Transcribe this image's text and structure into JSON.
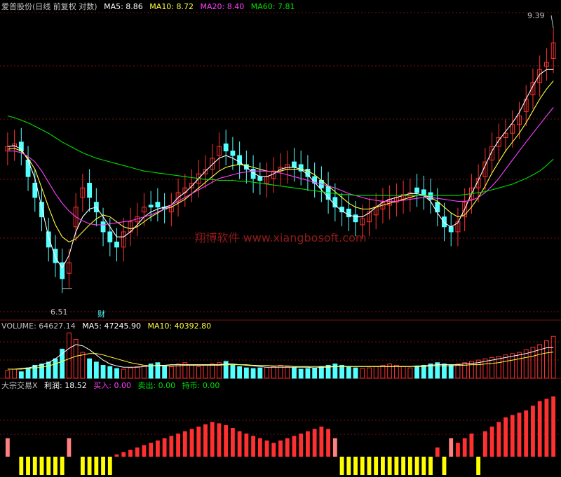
{
  "colors": {
    "background": "#000000",
    "up": "#ff3030",
    "down": "#54ffff",
    "ma5": "#ffffff",
    "ma10": "#ffff40",
    "ma20": "#ff40ff",
    "ma60": "#00e000",
    "grid": "#7a1010",
    "watermark": "#8c1a1a",
    "label": "#c0c0c0",
    "yellow_bar": "#ffff00",
    "pink_bar": "#ff8080",
    "teal_bar": "#33cccc"
  },
  "price_panel": {
    "title": "爱普股份(日线 前复权 对数)",
    "ma5": "MA5: 8.86",
    "ma10": "MA10: 8.72",
    "ma20": "MA20: 8.40",
    "ma60": "MA60: 7.81",
    "high_label": "9.39",
    "low_label": "6.51",
    "caifu_label": "财",
    "watermark": "翔博软件 www.xiangbosoft.com"
  },
  "volume_panel": {
    "title": "VOLUME: 64627.14",
    "ma5": "MA5: 47245.90",
    "ma10": "MA10: 40392.80"
  },
  "indicator_panel": {
    "title": "大宗交易X",
    "profit": "利润: 18.52",
    "buy": "买入: 0.00",
    "sell": "卖出: 0.00",
    "hold": "持币: 0.00"
  },
  "chart_data": {
    "type": "candlestick",
    "price_range": [
      6.3,
      9.6
    ],
    "high": 9.39,
    "low": 6.51,
    "closes": [
      7.95,
      7.98,
      7.9,
      7.62,
      7.4,
      7.2,
      6.9,
      6.75,
      6.6,
      6.75,
      7.3,
      7.5,
      7.4,
      7.25,
      7.05,
      6.95,
      6.9,
      7.05,
      7.15,
      7.2,
      7.3,
      7.3,
      7.3,
      7.28,
      7.3,
      7.45,
      7.5,
      7.55,
      7.65,
      7.7,
      7.82,
      7.95,
      7.9,
      7.85,
      7.75,
      7.7,
      7.6,
      7.58,
      7.62,
      7.68,
      7.72,
      7.75,
      7.72,
      7.68,
      7.62,
      7.55,
      7.5,
      7.38,
      7.3,
      7.25,
      7.2,
      7.15,
      7.18,
      7.25,
      7.3,
      7.35,
      7.38,
      7.4,
      7.43,
      7.45,
      7.45,
      7.42,
      7.38,
      7.25,
      7.1,
      7.05,
      7.15,
      7.35,
      7.5,
      7.6,
      7.78,
      7.95,
      8.05,
      8.1,
      8.2,
      8.3,
      8.5,
      8.7,
      8.86,
      8.95,
      9.2
    ],
    "opens": [
      7.9,
      7.95,
      8.0,
      7.8,
      7.55,
      7.35,
      7.05,
      6.88,
      6.75,
      6.65,
      7.1,
      7.4,
      7.55,
      7.35,
      7.15,
      7.05,
      6.95,
      6.9,
      7.05,
      7.15,
      7.25,
      7.32,
      7.35,
      7.3,
      7.25,
      7.35,
      7.45,
      7.5,
      7.55,
      7.65,
      7.7,
      7.85,
      7.98,
      7.9,
      7.85,
      7.75,
      7.7,
      7.62,
      7.55,
      7.6,
      7.68,
      7.7,
      7.78,
      7.75,
      7.7,
      7.62,
      7.58,
      7.52,
      7.4,
      7.3,
      7.28,
      7.22,
      7.12,
      7.15,
      7.22,
      7.28,
      7.32,
      7.35,
      7.38,
      7.4,
      7.5,
      7.48,
      7.45,
      7.35,
      7.2,
      7.1,
      7.05,
      7.2,
      7.38,
      7.5,
      7.62,
      7.8,
      7.95,
      8.05,
      8.1,
      8.2,
      8.35,
      8.55,
      8.7,
      8.9,
      9.0
    ],
    "ma5": [
      7.95,
      7.96,
      7.92,
      7.8,
      7.6,
      7.3,
      7.0,
      6.8,
      6.7,
      6.82,
      7.05,
      7.2,
      7.28,
      7.3,
      7.2,
      7.1,
      7.0,
      7.0,
      7.05,
      7.12,
      7.2,
      7.25,
      7.28,
      7.3,
      7.32,
      7.4,
      7.45,
      7.52,
      7.6,
      7.68,
      7.75,
      7.82,
      7.85,
      7.82,
      7.78,
      7.72,
      7.66,
      7.62,
      7.62,
      7.65,
      7.7,
      7.72,
      7.72,
      7.7,
      7.64,
      7.56,
      7.48,
      7.4,
      7.32,
      7.26,
      7.22,
      7.2,
      7.2,
      7.24,
      7.3,
      7.35,
      7.38,
      7.4,
      7.42,
      7.44,
      7.44,
      7.42,
      7.36,
      7.24,
      7.14,
      7.1,
      7.14,
      7.28,
      7.44,
      7.58,
      7.74,
      7.9,
      8.02,
      8.12,
      8.22,
      8.34,
      8.5,
      8.66,
      8.8,
      8.86,
      8.86
    ],
    "ma10": [
      7.92,
      7.93,
      7.9,
      7.82,
      7.7,
      7.5,
      7.3,
      7.12,
      7.0,
      6.95,
      6.98,
      7.05,
      7.12,
      7.18,
      7.22,
      7.2,
      7.15,
      7.1,
      7.08,
      7.1,
      7.15,
      7.2,
      7.24,
      7.28,
      7.3,
      7.34,
      7.38,
      7.44,
      7.5,
      7.56,
      7.62,
      7.68,
      7.72,
      7.74,
      7.75,
      7.74,
      7.72,
      7.7,
      7.68,
      7.67,
      7.68,
      7.7,
      7.7,
      7.7,
      7.68,
      7.64,
      7.58,
      7.52,
      7.46,
      7.4,
      7.34,
      7.3,
      7.28,
      7.28,
      7.3,
      7.32,
      7.34,
      7.36,
      7.38,
      7.4,
      7.42,
      7.42,
      7.4,
      7.36,
      7.3,
      7.24,
      7.2,
      7.22,
      7.3,
      7.4,
      7.52,
      7.66,
      7.78,
      7.9,
      8.0,
      8.1,
      8.22,
      8.36,
      8.5,
      8.62,
      8.72
    ],
    "ma20": [
      7.9,
      7.9,
      7.88,
      7.84,
      7.78,
      7.68,
      7.56,
      7.44,
      7.34,
      7.26,
      7.2,
      7.16,
      7.13,
      7.12,
      7.12,
      7.13,
      7.14,
      7.15,
      7.16,
      7.18,
      7.2,
      7.22,
      7.25,
      7.28,
      7.32,
      7.36,
      7.4,
      7.44,
      7.48,
      7.52,
      7.56,
      7.6,
      7.62,
      7.64,
      7.66,
      7.67,
      7.68,
      7.68,
      7.68,
      7.67,
      7.66,
      7.64,
      7.62,
      7.6,
      7.58,
      7.56,
      7.54,
      7.52,
      7.5,
      7.47,
      7.44,
      7.42,
      7.4,
      7.38,
      7.37,
      7.36,
      7.36,
      7.36,
      7.37,
      7.38,
      7.39,
      7.4,
      7.4,
      7.39,
      7.38,
      7.37,
      7.36,
      7.36,
      7.37,
      7.4,
      7.45,
      7.52,
      7.6,
      7.7,
      7.8,
      7.9,
      8.0,
      8.1,
      8.2,
      8.3,
      8.4
    ],
    "ma60": [
      8.3,
      8.28,
      8.25,
      8.22,
      8.18,
      8.14,
      8.1,
      8.05,
      8.0,
      7.96,
      7.92,
      7.88,
      7.85,
      7.82,
      7.8,
      7.78,
      7.76,
      7.74,
      7.72,
      7.7,
      7.68,
      7.67,
      7.66,
      7.65,
      7.64,
      7.63,
      7.62,
      7.61,
      7.6,
      7.59,
      7.59,
      7.58,
      7.58,
      7.58,
      7.57,
      7.57,
      7.56,
      7.55,
      7.54,
      7.53,
      7.52,
      7.51,
      7.5,
      7.49,
      7.48,
      7.47,
      7.46,
      7.45,
      7.44,
      7.43,
      7.43,
      7.42,
      7.42,
      7.42,
      7.42,
      7.42,
      7.42,
      7.42,
      7.42,
      7.42,
      7.42,
      7.42,
      7.42,
      7.42,
      7.42,
      7.42,
      7.42,
      7.43,
      7.44,
      7.45,
      7.46,
      7.48,
      7.5,
      7.52,
      7.54,
      7.57,
      7.6,
      7.64,
      7.68,
      7.74,
      7.81
    ],
    "volumes": [
      12,
      14,
      10,
      16,
      20,
      22,
      25,
      30,
      45,
      70,
      60,
      40,
      30,
      25,
      20,
      18,
      15,
      14,
      16,
      18,
      20,
      22,
      24,
      20,
      18,
      22,
      24,
      20,
      18,
      20,
      22,
      24,
      26,
      20,
      18,
      16,
      15,
      16,
      17,
      18,
      20,
      18,
      16,
      14,
      15,
      16,
      18,
      20,
      22,
      20,
      18,
      16,
      15,
      16,
      18,
      20,
      22,
      20,
      18,
      16,
      18,
      20,
      22,
      24,
      22,
      20,
      22,
      24,
      26,
      28,
      30,
      32,
      34,
      36,
      38,
      40,
      44,
      48,
      52,
      58,
      64.6
    ],
    "vol_ma5": [
      14,
      14,
      15,
      16,
      18,
      21,
      24,
      30,
      38,
      46,
      52,
      50,
      44,
      36,
      28,
      22,
      19,
      17,
      17,
      17,
      18,
      19,
      20,
      20,
      21,
      21,
      21,
      21,
      21,
      21,
      21,
      21,
      22,
      22,
      21,
      20,
      19,
      18,
      17,
      17,
      17,
      17,
      17,
      17,
      17,
      16,
      17,
      17,
      18,
      18,
      18,
      18,
      18,
      18,
      18,
      18,
      18,
      18,
      18,
      18,
      19,
      19,
      20,
      21,
      21,
      21,
      21,
      22,
      23,
      24,
      26,
      28,
      30,
      32,
      34,
      36,
      38,
      41,
      44,
      47,
      47.2
    ],
    "vol_ma10": [
      14,
      14,
      14,
      15,
      16,
      17,
      19,
      22,
      26,
      30,
      34,
      36,
      38,
      38,
      36,
      33,
      30,
      27,
      24,
      22,
      20,
      19,
      19,
      19,
      19,
      19,
      20,
      20,
      20,
      20,
      20,
      20,
      21,
      21,
      21,
      21,
      20,
      20,
      20,
      19,
      19,
      19,
      18,
      18,
      18,
      18,
      18,
      18,
      18,
      18,
      18,
      18,
      18,
      18,
      18,
      18,
      18,
      18,
      18,
      18,
      18,
      18,
      19,
      19,
      19,
      19,
      20,
      20,
      21,
      21,
      22,
      23,
      24,
      26,
      28,
      30,
      32,
      34,
      37,
      39,
      40.4
    ],
    "indicator": [
      1,
      0,
      -1,
      -1,
      -1,
      -1,
      -1,
      -1,
      -1,
      1,
      0,
      -1,
      -1,
      -1,
      -1,
      -1,
      0,
      0,
      0,
      0,
      0,
      0,
      0,
      0,
      0,
      0,
      0,
      0,
      0,
      0,
      0,
      0,
      0,
      0,
      0,
      0,
      0,
      0,
      0,
      0,
      0,
      0,
      0,
      0,
      0,
      0,
      0,
      0,
      1,
      -1,
      -1,
      -1,
      -1,
      -1,
      -1,
      -1,
      -1,
      -1,
      -1,
      -1,
      -1,
      -1,
      -1,
      0,
      -1,
      1,
      0,
      0,
      0,
      -1,
      0,
      0,
      0,
      0,
      0,
      0,
      0,
      0,
      0,
      0,
      0
    ],
    "indicator_values": [
      0.4,
      0,
      0.45,
      0.45,
      0.45,
      0.45,
      0.45,
      0.45,
      0.45,
      0.4,
      0,
      0.45,
      0.45,
      0.45,
      0.45,
      0.45,
      0.05,
      0.1,
      0.15,
      0.2,
      0.25,
      0.3,
      0.35,
      0.4,
      0.45,
      0.5,
      0.55,
      0.6,
      0.65,
      0.7,
      0.75,
      0.72,
      0.68,
      0.62,
      0.55,
      0.5,
      0.45,
      0.4,
      0.35,
      0.3,
      0.35,
      0.4,
      0.45,
      0.5,
      0.55,
      0.6,
      0.65,
      0.6,
      0.4,
      0.45,
      0.45,
      0.45,
      0.45,
      0.45,
      0.45,
      0.45,
      0.45,
      0.45,
      0.45,
      0.45,
      0.45,
      0.45,
      0.45,
      0.2,
      0.45,
      0.4,
      0.3,
      0.4,
      0.5,
      0.45,
      0.55,
      0.65,
      0.75,
      0.85,
      0.9,
      0.95,
      1.0,
      1.1,
      1.2,
      1.25,
      1.3
    ]
  }
}
